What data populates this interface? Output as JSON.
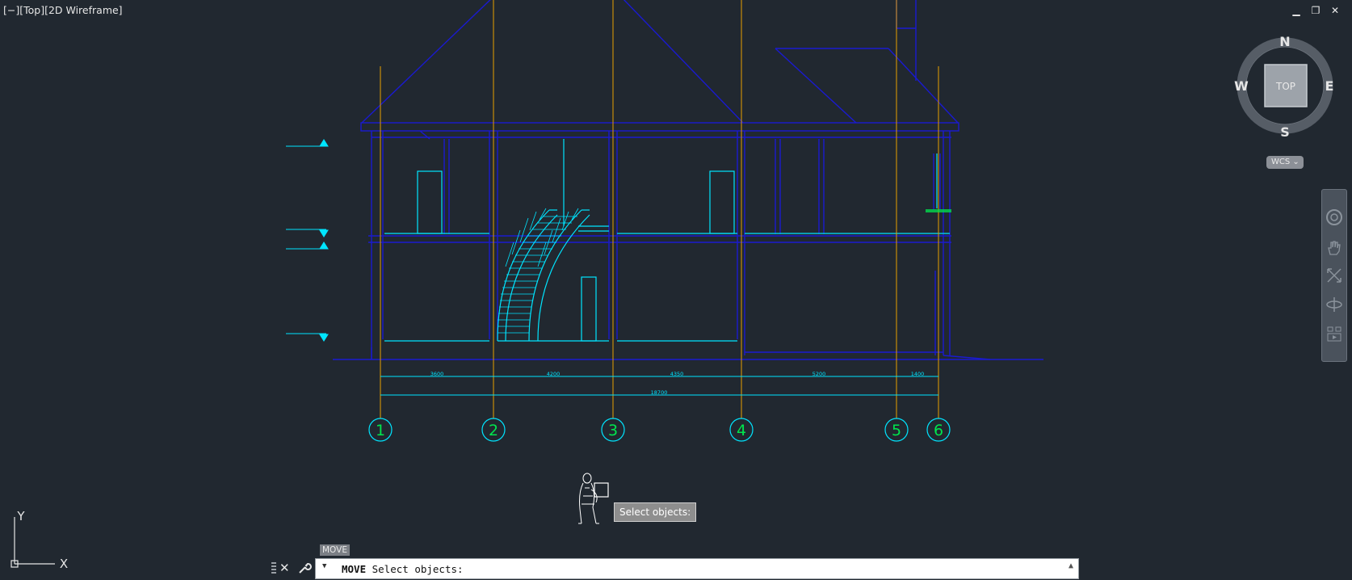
{
  "viewport": {
    "label": "[−][Top][2D Wireframe]"
  },
  "window_controls": {
    "minimize": "▁",
    "restore": "❐",
    "close": "✕"
  },
  "navcube": {
    "north": "N",
    "south": "S",
    "east": "E",
    "west": "W",
    "face": "TOP",
    "wcs_label": "WCS"
  },
  "navbar": {
    "tools": [
      "steering-wheel-icon",
      "pan-hand-icon",
      "zoom-extents-icon",
      "orbit-icon",
      "showmotion-icon"
    ]
  },
  "grid_bubbles": [
    "1",
    "2",
    "3",
    "4",
    "5",
    "6"
  ],
  "dimensions": {
    "spans": [
      "3600",
      "4200",
      "4350",
      "5200",
      "1400"
    ],
    "total": "18700"
  },
  "tooltip": {
    "text": "Select objects:"
  },
  "command": {
    "hint": "MOVE",
    "keyword": "MOVE",
    "prompt": " Select objects:"
  },
  "ucs": {
    "x": "X",
    "y": "Y"
  },
  "colors": {
    "background": "#212830",
    "wall_blue": "#1a1ad0",
    "cyan": "#00e5ff",
    "grid_orange": "#e8a000",
    "bubble_green": "#00e64d"
  }
}
